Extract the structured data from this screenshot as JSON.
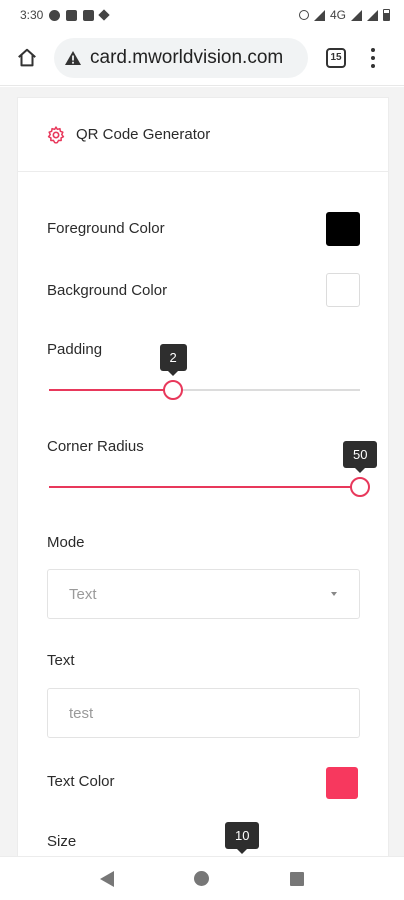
{
  "status_bar": {
    "time": "3:30",
    "network": "4G"
  },
  "browser": {
    "url": "card.mworldvision.com",
    "tab_count": "15"
  },
  "card": {
    "title": "QR Code Generator",
    "foreground": {
      "label": "Foreground Color",
      "color": "#000000"
    },
    "background": {
      "label": "Background Color",
      "color": "#ffffff"
    },
    "padding": {
      "label": "Padding",
      "value_text": "2",
      "value": 2,
      "fraction": 0.4
    },
    "corner_radius": {
      "label": "Corner Radius",
      "value_text": "50",
      "value": 50,
      "fraction": 1.0
    },
    "mode": {
      "label": "Mode",
      "selected": "Text"
    },
    "text": {
      "label": "Text",
      "value": "test"
    },
    "text_color": {
      "label": "Text Color",
      "color": "#f7385e"
    },
    "size": {
      "label": "Size",
      "value_text": "10"
    }
  },
  "colors": {
    "accent": "#e8385b"
  }
}
